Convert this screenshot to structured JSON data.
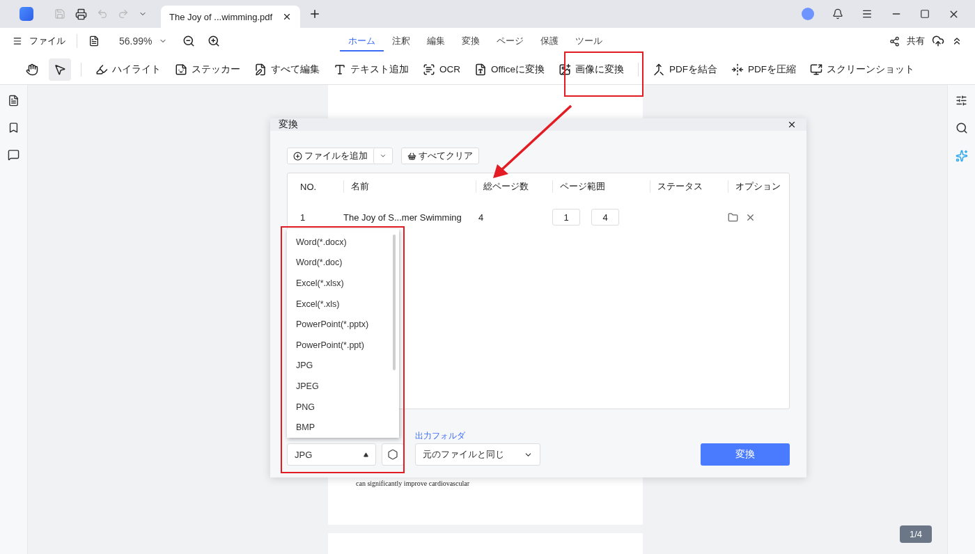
{
  "titlebar": {
    "tab_title": "The Joy of ...wimming.pdf"
  },
  "menubar": {
    "file": "ファイル",
    "zoom": "56.99%",
    "tabs": [
      {
        "label": "ホーム",
        "selected": true
      },
      {
        "label": "注釈",
        "selected": false
      },
      {
        "label": "編集",
        "selected": false
      },
      {
        "label": "変換",
        "selected": false
      },
      {
        "label": "ページ",
        "selected": false
      },
      {
        "label": "保護",
        "selected": false
      },
      {
        "label": "ツール",
        "selected": false
      }
    ],
    "share": "共有"
  },
  "toolbar": {
    "modes": [
      {
        "kind": "hand",
        "selected": false
      },
      {
        "kind": "pointer",
        "selected": true
      }
    ],
    "actions": [
      {
        "kind": "highlight",
        "label": "ハイライト"
      },
      {
        "kind": "sticker",
        "label": "ステッカー"
      },
      {
        "kind": "edit",
        "label": "すべて編集"
      },
      {
        "kind": "text",
        "label": "テキスト追加"
      },
      {
        "kind": "ocr",
        "label": "OCR"
      },
      {
        "kind": "office",
        "label": "Officeに変換"
      },
      {
        "kind": "image",
        "label": "画像に変換"
      },
      {
        "kind": "merge",
        "label": "PDFを結合"
      },
      {
        "kind": "compress",
        "label": "PDFを圧縮"
      },
      {
        "kind": "screenshot",
        "label": "スクリーンショット"
      }
    ]
  },
  "document": {
    "visible_line": "can significantly improve cardiovascular",
    "page_counter": "1/4"
  },
  "dialog": {
    "title": "変換",
    "add_file": "ファイルを追加",
    "clear_all": "すべてクリア",
    "columns": [
      "NO.",
      "名前",
      "総ページ数",
      "ページ範囲",
      "ステータス",
      "オプション"
    ],
    "rows": [
      {
        "no": "1",
        "name": "The Joy of S...mer Swimming",
        "pages": "4",
        "from": "1",
        "to": "4"
      }
    ],
    "format_options": [
      "Word(*.docx)",
      "Word(*.doc)",
      "Excel(*.xlsx)",
      "Excel(*.xls)",
      "PowerPoint(*.pptx)",
      "PowerPoint(*.ppt)",
      "JPG",
      "JPEG",
      "PNG",
      "BMP"
    ],
    "format": "JPG",
    "output_label": "出力フォルダ",
    "output_value": "元のファイルと同じ",
    "convert": "変換"
  }
}
